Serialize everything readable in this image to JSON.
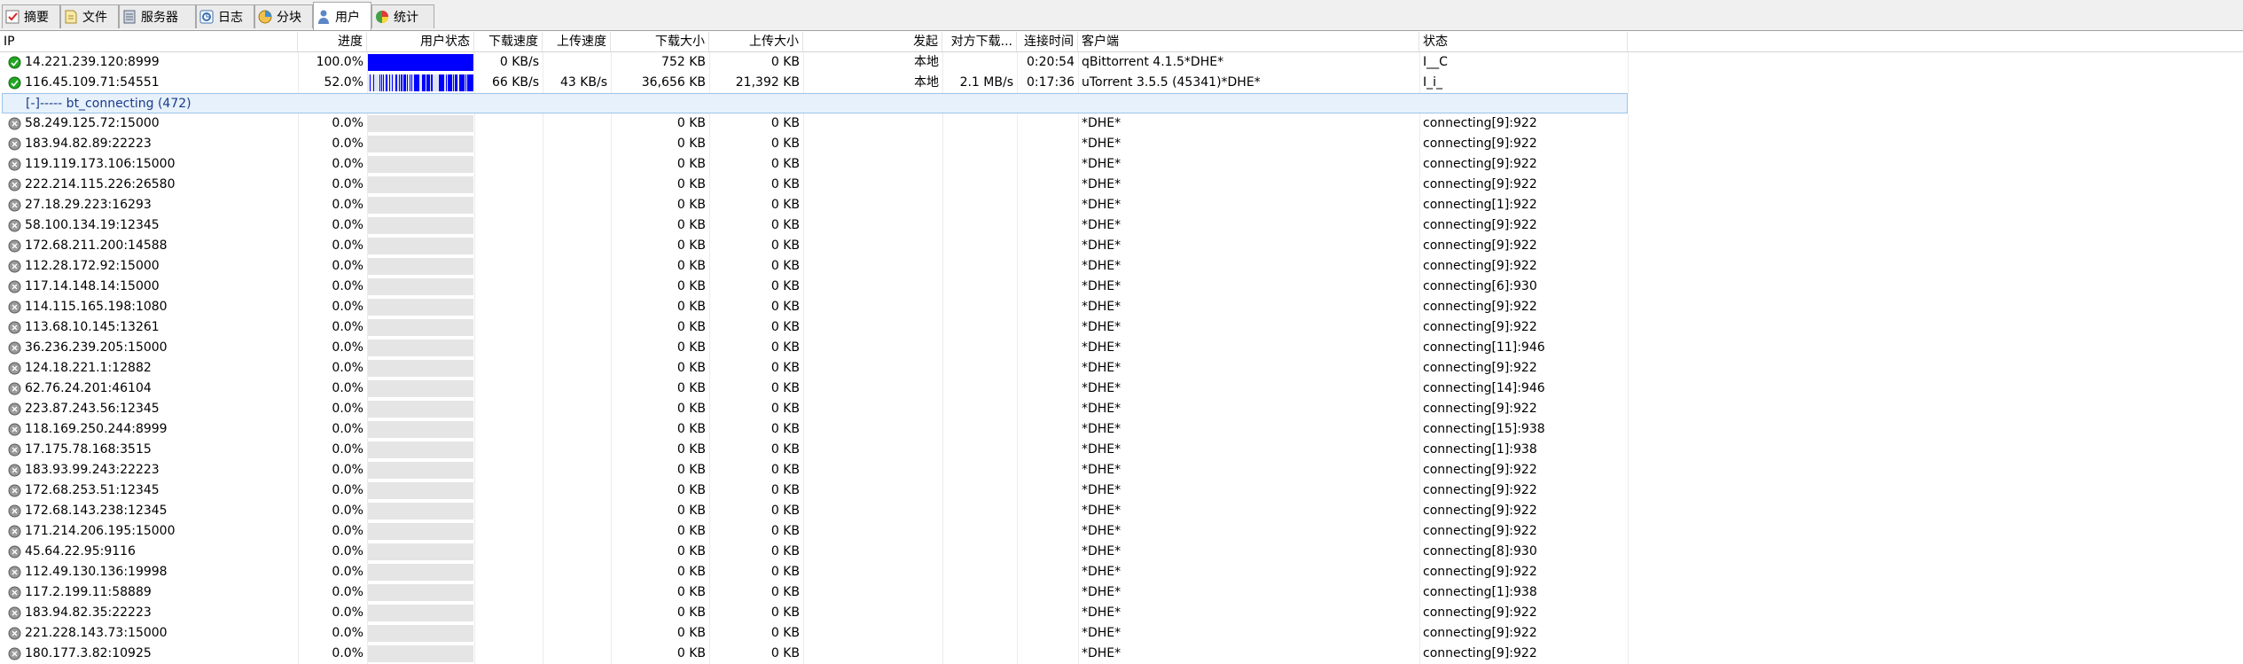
{
  "tabs": [
    {
      "label": "摘要",
      "icon": "summary-icon",
      "active": false
    },
    {
      "label": "文件",
      "icon": "files-icon",
      "active": false
    },
    {
      "label": "服务器",
      "icon": "server-icon",
      "active": false
    },
    {
      "label": "日志",
      "icon": "log-icon",
      "active": false
    },
    {
      "label": "分块",
      "icon": "pieces-icon",
      "active": false
    },
    {
      "label": "用户",
      "icon": "peers-icon",
      "active": true
    },
    {
      "label": "统计",
      "icon": "stats-icon",
      "active": false
    }
  ],
  "columns": {
    "ip": "IP",
    "progress": "进度",
    "peer_status": "用户状态",
    "down_speed": "下载速度",
    "up_speed": "上传速度",
    "downloaded": "下载大小",
    "uploaded": "上传大小",
    "origin": "发起",
    "remote_down": "对方下载...",
    "conn_time": "连接时间",
    "client": "客户端",
    "status": "状态"
  },
  "colors": {
    "connected": "#22a722",
    "bar_fill": "#0000ff",
    "group_bg": "#e7f1fb",
    "group_border": "#9cc3ea"
  },
  "connected_peers": [
    {
      "ip": "14.221.239.120:8999",
      "progress": "100.0%",
      "progress_value": 1.0,
      "down_speed": "0 KB/s",
      "up_speed": "",
      "downloaded": "752 KB",
      "uploaded": "0 KB",
      "origin": "本地",
      "remote_down": "",
      "conn_time": "0:20:54",
      "client": "qBittorrent 4.1.5*DHE*",
      "status": "I__C"
    },
    {
      "ip": "116.45.109.71:54551",
      "progress": "52.0%",
      "progress_value": 0.52,
      "down_speed": "66 KB/s",
      "up_speed": "43 KB/s",
      "downloaded": "36,656 KB",
      "uploaded": "21,392 KB",
      "origin": "本地",
      "remote_down": "2.1 MB/s",
      "conn_time": "0:17:36",
      "client": "uTorrent 3.5.5 (45341)*DHE*",
      "status": "I_i_"
    }
  ],
  "group": {
    "label": "[-]----- bt_connecting (472)"
  },
  "connecting_peers": [
    {
      "ip": "58.249.125.72:15000",
      "progress": "0.0%",
      "downloaded": "0 KB",
      "uploaded": "0 KB",
      "client": "*DHE*",
      "status": "connecting[9]:922"
    },
    {
      "ip": "183.94.82.89:22223",
      "progress": "0.0%",
      "downloaded": "0 KB",
      "uploaded": "0 KB",
      "client": "*DHE*",
      "status": "connecting[9]:922"
    },
    {
      "ip": "119.119.173.106:15000",
      "progress": "0.0%",
      "downloaded": "0 KB",
      "uploaded": "0 KB",
      "client": "*DHE*",
      "status": "connecting[9]:922"
    },
    {
      "ip": "222.214.115.226:26580",
      "progress": "0.0%",
      "downloaded": "0 KB",
      "uploaded": "0 KB",
      "client": "*DHE*",
      "status": "connecting[9]:922"
    },
    {
      "ip": "27.18.29.223:16293",
      "progress": "0.0%",
      "downloaded": "0 KB",
      "uploaded": "0 KB",
      "client": "*DHE*",
      "status": "connecting[1]:922"
    },
    {
      "ip": "58.100.134.19:12345",
      "progress": "0.0%",
      "downloaded": "0 KB",
      "uploaded": "0 KB",
      "client": "*DHE*",
      "status": "connecting[9]:922"
    },
    {
      "ip": "172.68.211.200:14588",
      "progress": "0.0%",
      "downloaded": "0 KB",
      "uploaded": "0 KB",
      "client": "*DHE*",
      "status": "connecting[9]:922"
    },
    {
      "ip": "112.28.172.92:15000",
      "progress": "0.0%",
      "downloaded": "0 KB",
      "uploaded": "0 KB",
      "client": "*DHE*",
      "status": "connecting[9]:922"
    },
    {
      "ip": "117.14.148.14:15000",
      "progress": "0.0%",
      "downloaded": "0 KB",
      "uploaded": "0 KB",
      "client": "*DHE*",
      "status": "connecting[6]:930"
    },
    {
      "ip": "114.115.165.198:1080",
      "progress": "0.0%",
      "downloaded": "0 KB",
      "uploaded": "0 KB",
      "client": "*DHE*",
      "status": "connecting[9]:922"
    },
    {
      "ip": "113.68.10.145:13261",
      "progress": "0.0%",
      "downloaded": "0 KB",
      "uploaded": "0 KB",
      "client": "*DHE*",
      "status": "connecting[9]:922"
    },
    {
      "ip": "36.236.239.205:15000",
      "progress": "0.0%",
      "downloaded": "0 KB",
      "uploaded": "0 KB",
      "client": "*DHE*",
      "status": "connecting[11]:946"
    },
    {
      "ip": "124.18.221.1:12882",
      "progress": "0.0%",
      "downloaded": "0 KB",
      "uploaded": "0 KB",
      "client": "*DHE*",
      "status": "connecting[9]:922"
    },
    {
      "ip": "62.76.24.201:46104",
      "progress": "0.0%",
      "downloaded": "0 KB",
      "uploaded": "0 KB",
      "client": "*DHE*",
      "status": "connecting[14]:946"
    },
    {
      "ip": "223.87.243.56:12345",
      "progress": "0.0%",
      "downloaded": "0 KB",
      "uploaded": "0 KB",
      "client": "*DHE*",
      "status": "connecting[9]:922"
    },
    {
      "ip": "118.169.250.244:8999",
      "progress": "0.0%",
      "downloaded": "0 KB",
      "uploaded": "0 KB",
      "client": "*DHE*",
      "status": "connecting[15]:938"
    },
    {
      "ip": "17.175.78.168:3515",
      "progress": "0.0%",
      "downloaded": "0 KB",
      "uploaded": "0 KB",
      "client": "*DHE*",
      "status": "connecting[1]:938"
    },
    {
      "ip": "183.93.99.243:22223",
      "progress": "0.0%",
      "downloaded": "0 KB",
      "uploaded": "0 KB",
      "client": "*DHE*",
      "status": "connecting[9]:922"
    },
    {
      "ip": "172.68.253.51:12345",
      "progress": "0.0%",
      "downloaded": "0 KB",
      "uploaded": "0 KB",
      "client": "*DHE*",
      "status": "connecting[9]:922"
    },
    {
      "ip": "172.68.143.238:12345",
      "progress": "0.0%",
      "downloaded": "0 KB",
      "uploaded": "0 KB",
      "client": "*DHE*",
      "status": "connecting[9]:922"
    },
    {
      "ip": "171.214.206.195:15000",
      "progress": "0.0%",
      "downloaded": "0 KB",
      "uploaded": "0 KB",
      "client": "*DHE*",
      "status": "connecting[9]:922"
    },
    {
      "ip": "45.64.22.95:9116",
      "progress": "0.0%",
      "downloaded": "0 KB",
      "uploaded": "0 KB",
      "client": "*DHE*",
      "status": "connecting[8]:930"
    },
    {
      "ip": "112.49.130.136:19998",
      "progress": "0.0%",
      "downloaded": "0 KB",
      "uploaded": "0 KB",
      "client": "*DHE*",
      "status": "connecting[9]:922"
    },
    {
      "ip": "117.2.199.11:58889",
      "progress": "0.0%",
      "downloaded": "0 KB",
      "uploaded": "0 KB",
      "client": "*DHE*",
      "status": "connecting[1]:938"
    },
    {
      "ip": "183.94.82.35:22223",
      "progress": "0.0%",
      "downloaded": "0 KB",
      "uploaded": "0 KB",
      "client": "*DHE*",
      "status": "connecting[9]:922"
    },
    {
      "ip": "221.228.143.73:15000",
      "progress": "0.0%",
      "downloaded": "0 KB",
      "uploaded": "0 KB",
      "client": "*DHE*",
      "status": "connecting[9]:922"
    },
    {
      "ip": "180.177.3.82:10925",
      "progress": "0.0%",
      "downloaded": "0 KB",
      "uploaded": "0 KB",
      "client": "*DHE*",
      "status": "connecting[9]:922"
    }
  ]
}
